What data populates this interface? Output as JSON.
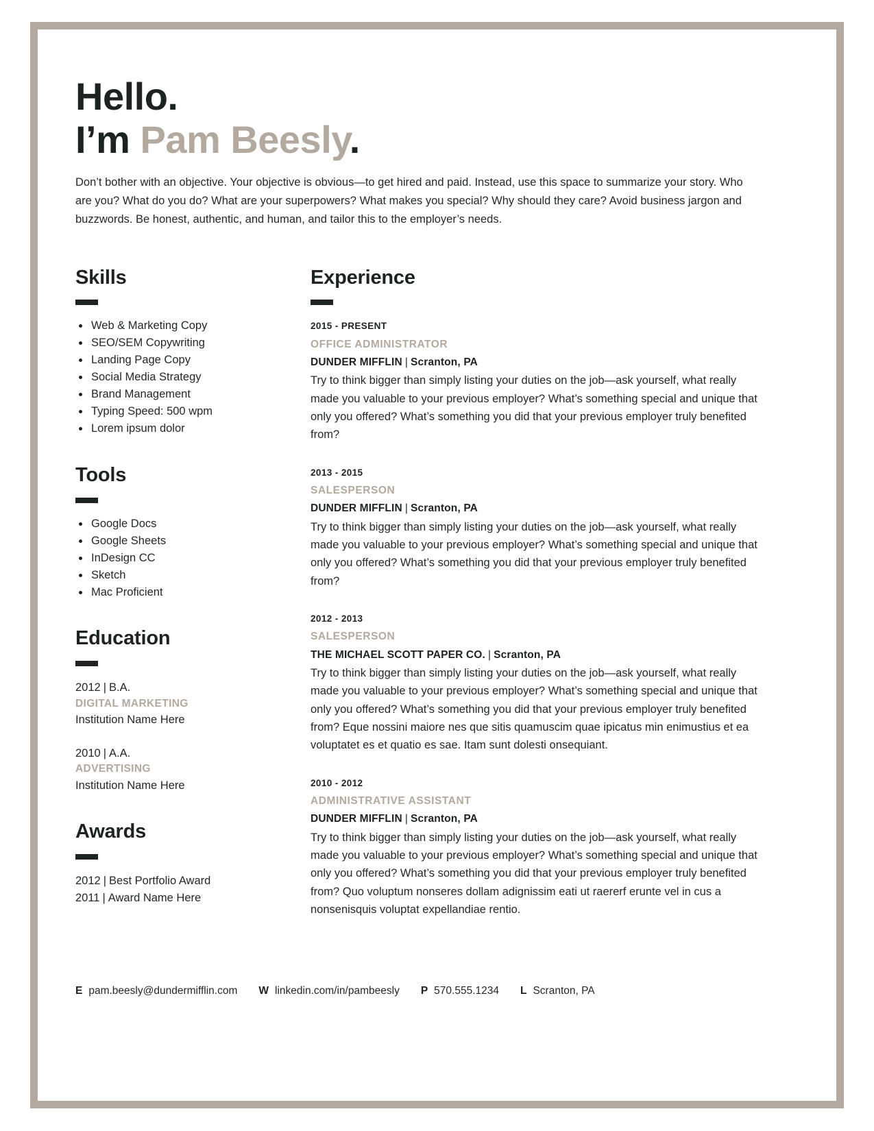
{
  "header": {
    "greeting": "Hello.",
    "intro_prefix": "I’m ",
    "name": "Pam Beesly",
    "name_period": ".",
    "summary": "Don’t bother with an objective. Your objective is obvious—to get hired and paid. Instead, use this space to summarize your story. Who are you? What do you do? What are your superpowers? What makes you special? Why should they care? Avoid business jargon and buzzwords. Be honest, authentic, and human, and tailor this to the employer’s needs."
  },
  "skills": {
    "title": "Skills",
    "items": [
      "Web & Marketing Copy",
      "SEO/SEM Copywriting",
      "Landing Page Copy",
      "Social Media Strategy",
      "Brand Management",
      "Typing Speed: 500 wpm",
      "Lorem ipsum dolor"
    ]
  },
  "tools": {
    "title": "Tools",
    "items": [
      "Google Docs",
      "Google Sheets",
      "InDesign CC",
      "Sketch",
      "Mac Proficient"
    ]
  },
  "education": {
    "title": "Education",
    "entries": [
      {
        "year": "2012",
        "separator": "|",
        "degree": "B.A.",
        "field": "DIGITAL MARKETING",
        "institution": "Institution Name Here"
      },
      {
        "year": "2010",
        "separator": "|",
        "degree": "A.A.",
        "field": "ADVERTISING",
        "institution": "Institution Name Here"
      }
    ]
  },
  "awards": {
    "title": "Awards",
    "entries": [
      {
        "year": "2012",
        "separator": "|",
        "name": "Best Portfolio Award"
      },
      {
        "year": "2011",
        "separator": "|",
        "name": "Award Name Here"
      }
    ]
  },
  "experience": {
    "title": "Experience",
    "jobs": [
      {
        "dates": "2015 - PRESENT",
        "role": "OFFICE ADMINISTRATOR",
        "company": "DUNDER MIFFLIN",
        "separator": "|",
        "location": "Scranton, PA",
        "description": "Try to think bigger than simply listing your duties on the job—ask yourself, what really made you valuable to your previous employer? What’s something special and unique that only you offered? What’s something you did that your previous employer truly benefited from?"
      },
      {
        "dates": "2013 - 2015",
        "role": "SALESPERSON",
        "company": "DUNDER MIFFLIN",
        "separator": "|",
        "location": "Scranton, PA",
        "description": "Try to think bigger than simply listing your duties on the job—ask yourself, what really made you valuable to your previous employer? What’s something special and unique that only you offered? What’s something you did that your previous employer truly benefited from?"
      },
      {
        "dates": "2012 - 2013",
        "role": "SALESPERSON",
        "company": "THE MICHAEL SCOTT PAPER CO.",
        "separator": "|",
        "location": "Scranton, PA",
        "description": "Try to think bigger than simply listing your duties on the job—ask yourself, what really made you valuable to your previous employer? What’s something special and unique that only you offered? What’s something you did that your previous employer truly benefited from? Eque nossini maiore nes que sitis quamuscim quae ipicatus min enimustius et ea voluptatet es et quatio es sae. Itam sunt dolesti onsequiant."
      },
      {
        "dates": "2010 - 2012",
        "role": "ADMINISTRATIVE ASSISTANT",
        "company": "DUNDER MIFFLIN",
        "separator": "|",
        "location": "Scranton, PA",
        "description": "Try to think bigger than simply listing your duties on the job—ask yourself, what really made you valuable to your previous employer? What’s something special and unique that only you offered? What’s something you did that your previous employer truly benefited from? Quo voluptum nonseres dollam adignissim eati ut raererf erunte vel in cus a nonsenisquis voluptat expellandiae rentio."
      }
    ]
  },
  "footer": {
    "email_key": "E",
    "email": "pam.beesly@dundermifflin.com",
    "web_key": "W",
    "web": "linkedin.com/in/pambeesly",
    "phone_key": "P",
    "phone": "570.555.1234",
    "location_key": "L",
    "location": "Scranton, PA"
  },
  "colors": {
    "accent": "#b3a99e",
    "ink": "#1d2420",
    "body": "#23282a"
  }
}
